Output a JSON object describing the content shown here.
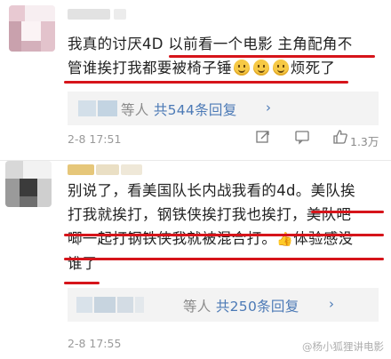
{
  "comments": [
    {
      "text_lines": [
        "我真的讨厌4D ",
        "以前看一个电影 主角配角不",
        "管谁挨打我都要被椅子锤",
        "烦死了"
      ],
      "reply_count_prefix": "等人",
      "reply_link": "共544条回复",
      "time": "2-8 17:51",
      "likes": "1.3万"
    },
    {
      "text_lines": [
        "别说了，看美国队长内战我看的4d。",
        "美队挨",
        "打我就挨打，钢铁侠挨打我也挨打，美队吧",
        "唧一起打钢铁侠我就被混合打。",
        "体验感没",
        "谁了"
      ],
      "reply_count_prefix": "等人",
      "reply_link": "共250条回复",
      "time": "2-8 17:55"
    }
  ],
  "watermark": "@杨小狐狸讲电影",
  "colors": {
    "underline": "#d6141a",
    "link": "#4c7ab6",
    "reply_bg": "#f3f3f3"
  },
  "icons": [
    "share-icon",
    "comment-icon",
    "like-icon",
    "smile-emoji",
    "thumbs-up-emoji"
  ]
}
